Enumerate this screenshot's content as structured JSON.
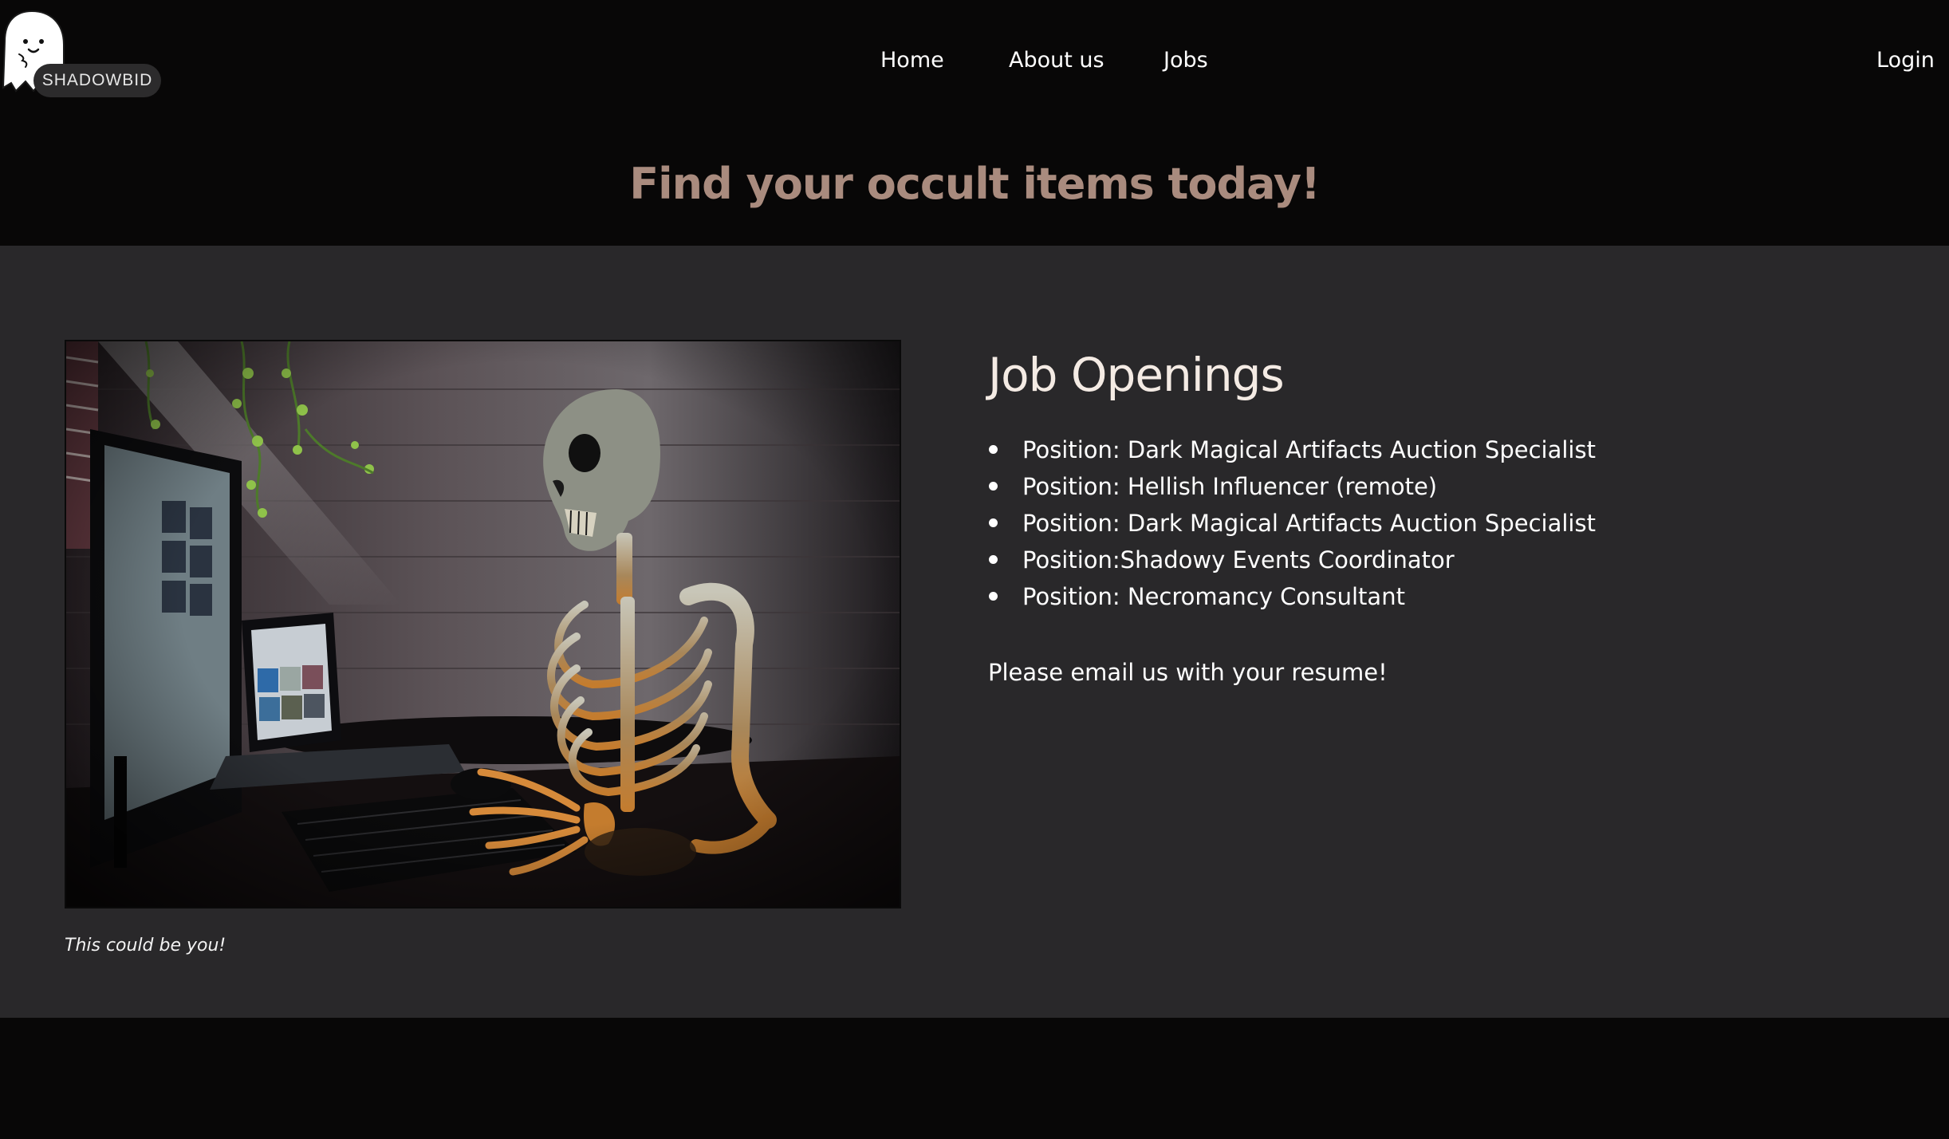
{
  "logo": {
    "text": "SHADOWBID",
    "icon": "ghost-icon"
  },
  "nav": {
    "links": [
      {
        "label": "Home"
      },
      {
        "label": "About us"
      },
      {
        "label": "Jobs"
      }
    ],
    "login": "Login"
  },
  "hero": {
    "title": "Find your occult items today!"
  },
  "main": {
    "image": {
      "subject": "skeleton-at-computer-desk"
    },
    "caption": "This could be you!",
    "heading": "Job Openings",
    "positions": [
      "Position: Dark Magical Artifacts Auction Specialist",
      "Position: Hellish Influencer (remote)",
      "Position: Dark Magical Artifacts Auction Specialist",
      "Position:Shadowy Events Coordinator",
      "Position: Necromancy Consultant"
    ],
    "email_note": "Please email us with your resume!"
  },
  "colors": {
    "page_background": "#080707",
    "content_background": "#29282a",
    "hero_title": "#a98b7e",
    "heading": "#f4ebe4",
    "text": "#ffffff"
  }
}
